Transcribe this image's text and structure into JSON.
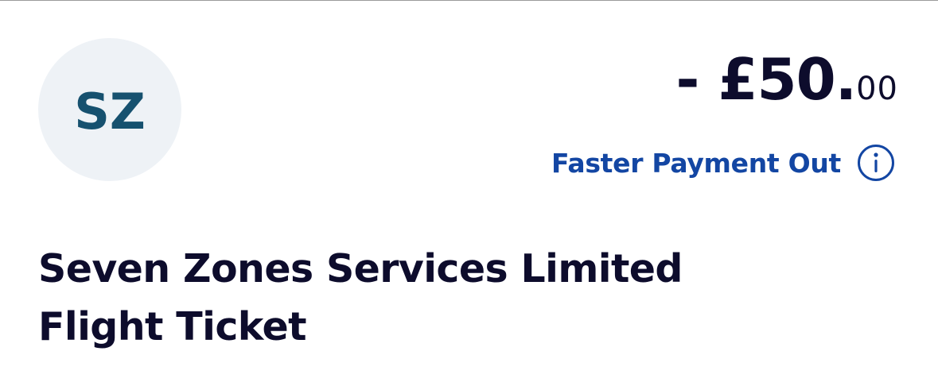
{
  "transaction": {
    "avatar_initials": "SZ",
    "amount_main": "- £50.",
    "amount_pence": "00",
    "payment_type": "Faster Payment Out",
    "info_icon": "info-icon",
    "payee_name": "Seven Zones Services Limited",
    "reference": "Flight Ticket"
  },
  "colors": {
    "background": "#ffffff",
    "avatar_background": "#eef2f6",
    "avatar_text": "#16516f",
    "primary_text": "#0d0c2c",
    "accent_blue": "#1346a3"
  }
}
